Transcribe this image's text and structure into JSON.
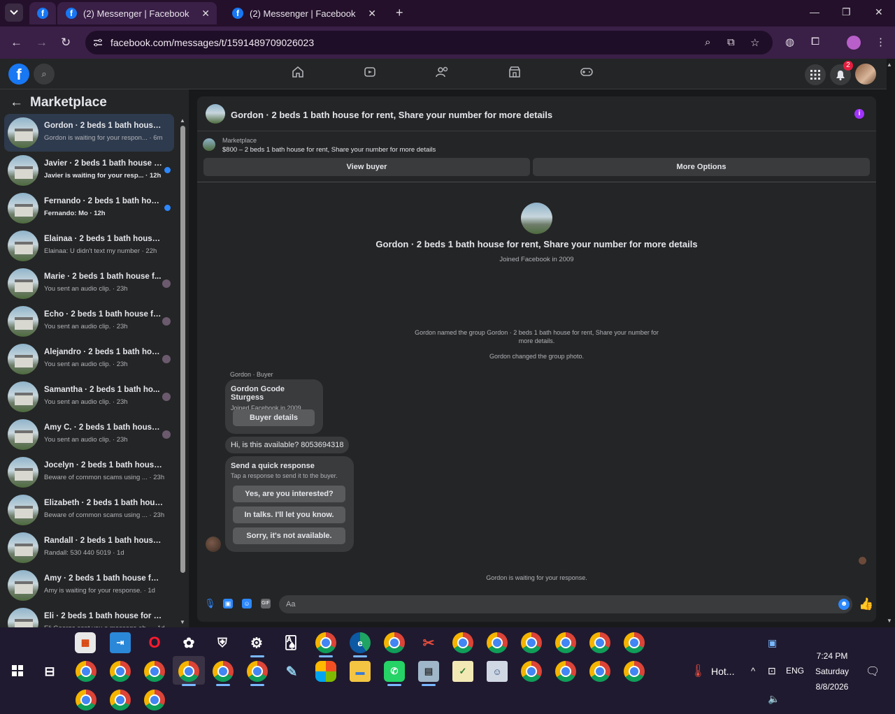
{
  "browser": {
    "tabs": [
      {
        "title": "(2) Messenger | Facebook",
        "active": true
      },
      {
        "title": "(2) Messenger | Facebook",
        "active": false
      }
    ],
    "url": "facebook.com/messages/t/1591489709026023"
  },
  "fb_header": {
    "notification_count": "2"
  },
  "left_panel": {
    "title": "Marketplace",
    "conversations": [
      {
        "name": "Gordon · 2 beds 1 bath house f...",
        "preview": "Gordon is waiting for your respon... · 6m",
        "active": true,
        "unread": false
      },
      {
        "name": "Javier · 2 beds 1 bath house f...",
        "preview": "Javier is waiting for your resp... · 12h",
        "active": false,
        "unread": true
      },
      {
        "name": "Fernando · 2 beds 1 bath hous...",
        "preview": "Fernando: Mo · 12h",
        "active": false,
        "unread": true
      },
      {
        "name": "Elainaa · 2 beds 1 bath house fo...",
        "preview": "Elainaa: U didn't text my number · 22h",
        "active": false,
        "unread": false
      },
      {
        "name": "Marie · 2 beds 1 bath house f...",
        "preview": "You sent an audio clip. · 23h",
        "active": false,
        "unread": false
      },
      {
        "name": "Echo · 2 beds 1 bath house fo...",
        "preview": "You sent an audio clip. · 23h",
        "active": false,
        "unread": false
      },
      {
        "name": "Alejandro · 2 beds 1 bath house...",
        "preview": "You sent an audio clip. · 23h",
        "active": false,
        "unread": false
      },
      {
        "name": "Samantha · 2 beds 1 bath ho...",
        "preview": "You sent an audio clip. · 23h",
        "active": false,
        "unread": false
      },
      {
        "name": "Amy C. · 2 beds 1 bath house ...",
        "preview": "You sent an audio clip. · 23h",
        "active": false,
        "unread": false
      },
      {
        "name": "Jocelyn · 2 beds 1 bath house fo...",
        "preview": "Beware of common scams using ... · 23h",
        "active": false,
        "unread": false
      },
      {
        "name": "Elizabeth · 2 beds 1 bath house ...",
        "preview": "Beware of common scams using ... · 23h",
        "active": false,
        "unread": false
      },
      {
        "name": "Randall · 2 beds 1 bath house f...",
        "preview": "Randall: 530 440 5019 · 1d",
        "active": false,
        "unread": false
      },
      {
        "name": "Amy · 2 beds 1 bath house for r...",
        "preview": "Amy is waiting for your response. · 1d",
        "active": false,
        "unread": false
      },
      {
        "name": "Eli · 2 beds 1 bath house for ren...",
        "preview": "Eli George sent you a message ab... · 1d",
        "active": false,
        "unread": false
      }
    ]
  },
  "chat": {
    "header_title": "Gordon · 2 beds 1 bath house for rent, Share your number for more details",
    "listing_source": "Marketplace",
    "listing_desc": "$800 – 2 beds 1 bath house for rent, Share your number for more details",
    "view_buyer_label": "View buyer",
    "more_options_label": "More Options",
    "intro_title": "Gordon · 2 beds 1 bath house for rent, Share your number for more details",
    "intro_sub": "Joined Facebook in 2009",
    "system_msg_1": "Gordon named the group Gordon · 2 beds 1 bath house for rent, Share your number for more details.",
    "system_msg_2": "Gordon changed the group photo.",
    "sender_label": "Gordon · Buyer",
    "buyer_card_name": "Gordon Gcode Sturgess",
    "buyer_card_sub": "Joined Facebook in 2009",
    "buyer_details_label": "Buyer details",
    "message_1": "Hi, is this available? 8053694318",
    "quick_title": "Send a quick response",
    "quick_sub": "Tap a response to send it to the buyer.",
    "quick_options": [
      "Yes, are you interested?",
      "In talks. I'll let you know.",
      "Sorry, it's not available."
    ],
    "waiting_text": "Gordon is waiting for your response.",
    "composer_placeholder": "Aa"
  },
  "taskbar": {
    "weather_text": "Hot...",
    "language": "ENG",
    "time": "7:24 PM",
    "day": "Saturday",
    "date": "8/8/2026"
  }
}
